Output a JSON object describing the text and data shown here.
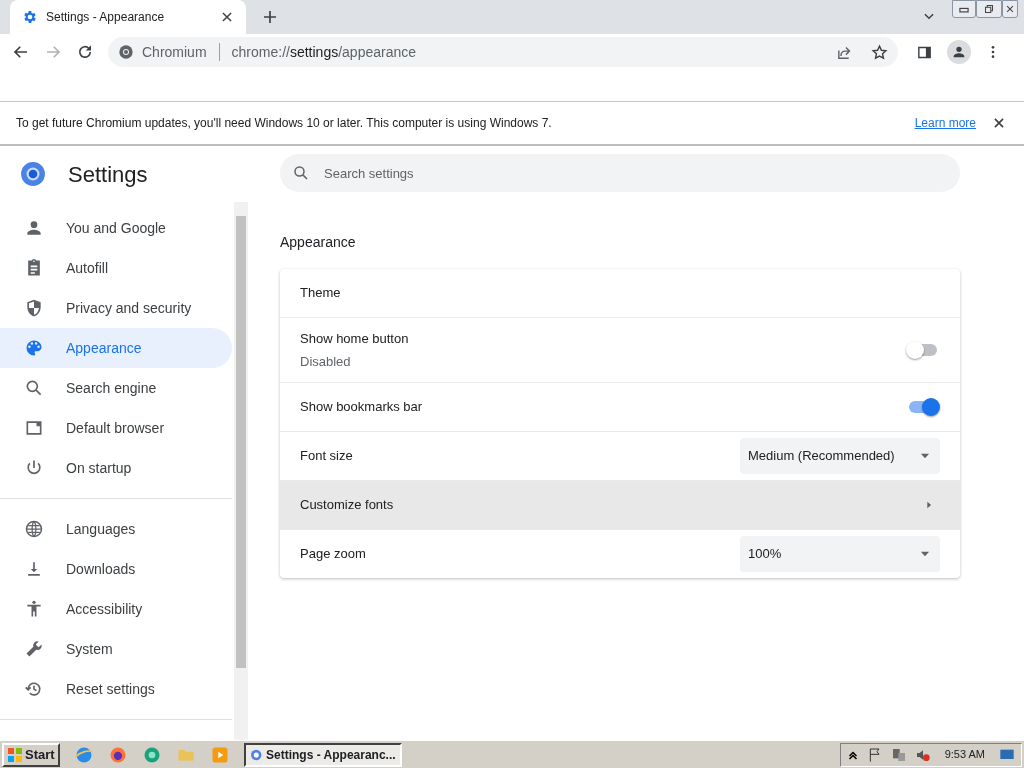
{
  "tab": {
    "title": "Settings - Appearance",
    "selected": true
  },
  "toolbar": {
    "site_label": "Chromium",
    "url_scheme": "chrome://",
    "url_host": "settings",
    "url_path": "/appearance"
  },
  "infobar": {
    "message": "To get future Chromium updates, you'll need Windows 10 or later. This computer is using Windows 7.",
    "link": "Learn more"
  },
  "header": {
    "title": "Settings",
    "search_placeholder": "Search settings"
  },
  "sidebar": {
    "groups": [
      [
        {
          "label": "You and Google",
          "selected": false
        },
        {
          "label": "Autofill",
          "selected": false
        },
        {
          "label": "Privacy and security",
          "selected": false
        },
        {
          "label": "Appearance",
          "selected": true
        },
        {
          "label": "Search engine",
          "selected": false
        },
        {
          "label": "Default browser",
          "selected": false
        },
        {
          "label": "On startup",
          "selected": false
        }
      ],
      [
        {
          "label": "Languages",
          "selected": false
        },
        {
          "label": "Downloads",
          "selected": false
        },
        {
          "label": "Accessibility",
          "selected": false
        },
        {
          "label": "System",
          "selected": false
        },
        {
          "label": "Reset settings",
          "selected": false
        }
      ]
    ]
  },
  "section": {
    "title": "Appearance",
    "rows": [
      {
        "kind": "plain",
        "label": "Theme",
        "hovered": false
      },
      {
        "kind": "toggle",
        "label": "Show home button",
        "sublabel": "Disabled",
        "on": false,
        "hovered": false
      },
      {
        "kind": "toggle",
        "label": "Show bookmarks bar",
        "on": true,
        "hovered": false
      },
      {
        "kind": "select",
        "label": "Font size",
        "value": "Medium (Recommended)",
        "hovered": false
      },
      {
        "kind": "submenu",
        "label": "Customize fonts",
        "hovered": true
      },
      {
        "kind": "select",
        "label": "Page zoom",
        "value": "100%",
        "hovered": false
      }
    ]
  },
  "taskbar": {
    "start": "Start",
    "task": "Settings - Appearanc...",
    "time": "9:53 AM"
  }
}
